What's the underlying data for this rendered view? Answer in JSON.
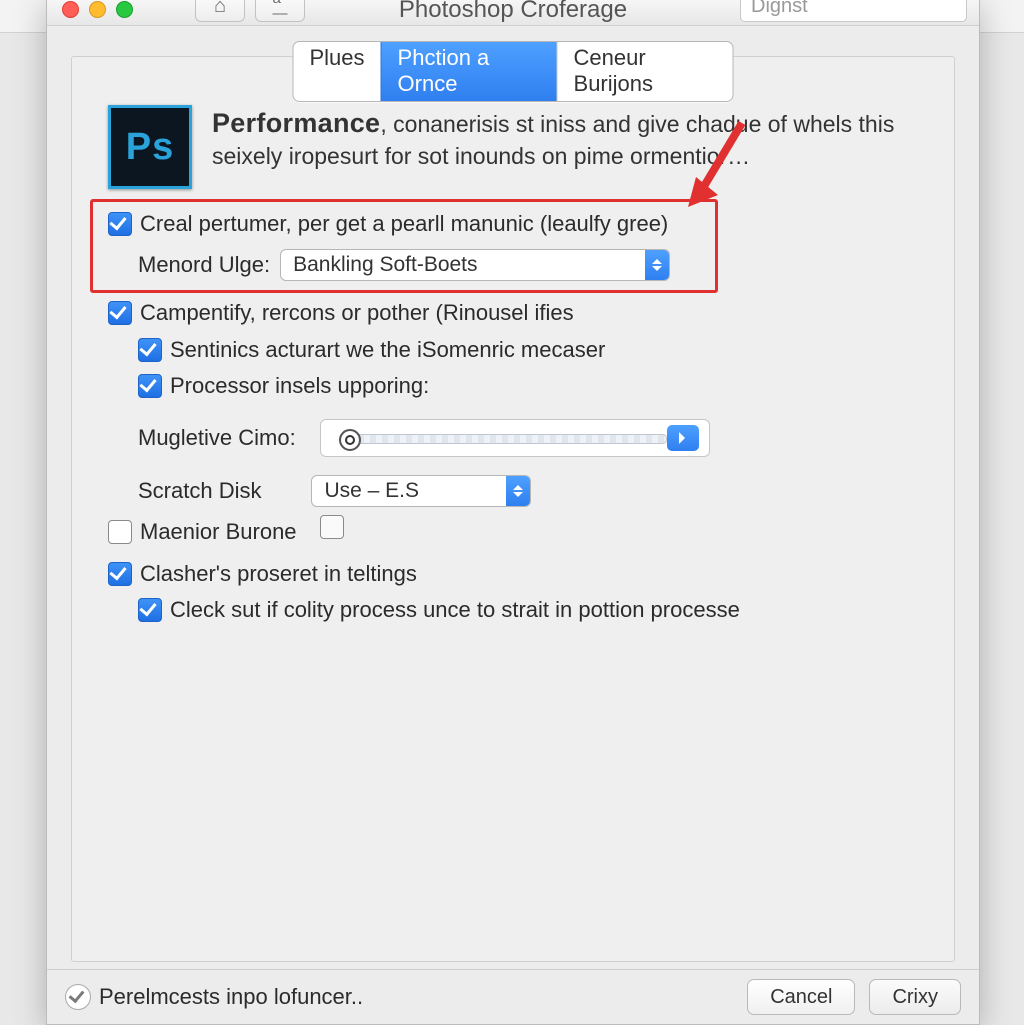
{
  "titlebar": {
    "title": "Photoshop Croferage",
    "search_placeholder": "Dignst"
  },
  "tabs": {
    "items": [
      "Plues",
      "Phction a Ornce",
      "Ceneur Burijons"
    ],
    "active_index": 1
  },
  "header": {
    "bold": "Performance",
    "rest": ", conanerisis st iniss and give chadue of whels this seixely iropesurt for sot inounds on pime ormentior…",
    "icon_label": "Ps"
  },
  "options": {
    "opt1": {
      "checked": true,
      "label": "Creal pertumer, per get a pearll manunic (leaulfy gree)"
    },
    "opt1_sub": {
      "label": "Menord Ulge:",
      "select_value": "Bankling Soft-Boets"
    },
    "opt2": {
      "checked": true,
      "label": "Campentify, rercons or pother (Rinousel ifies"
    },
    "opt2a": {
      "checked": true,
      "label": "Sentinics acturart we the iSomenric mecaser"
    },
    "opt2b": {
      "checked": true,
      "label": "Processor insels upporing:"
    },
    "slider_label": "Mugletive Cimo:",
    "scratch": {
      "label": "Scratch Disk",
      "select_value": "Use – E.S"
    },
    "opt5": {
      "checked": false,
      "label": "Maenior Burone"
    },
    "opt6": {
      "checked": true,
      "label": "Clasher's proseret in teltings"
    },
    "opt6a": {
      "checked": true,
      "label": "Cleck sut if colity process unce to strait in pottion processe"
    }
  },
  "footer": {
    "checkbox_label": "Perelmcests inpo lofuncer..",
    "cancel": "Cancel",
    "ok": "Crixy"
  }
}
